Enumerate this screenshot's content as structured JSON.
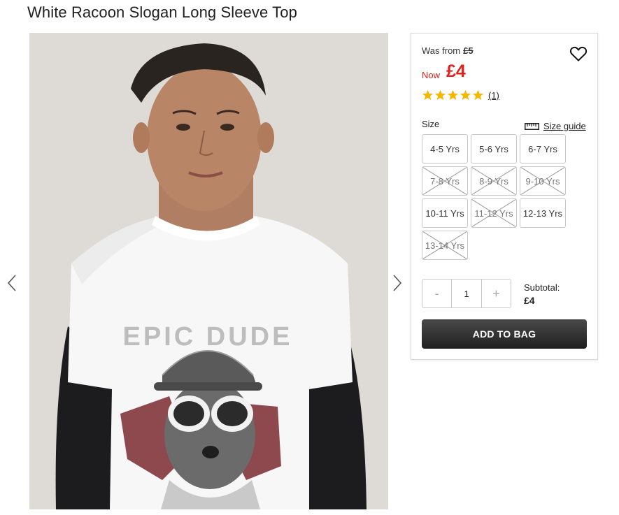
{
  "product": {
    "title": "White Racoon Slogan Long Sleeve Top",
    "image_alt": "Boy wearing white racoon slogan long sleeve top",
    "shirt_text": "EPIC DUDE"
  },
  "icons": {
    "prev": "chevron-left-icon",
    "next": "chevron-right-icon",
    "wishlist": "heart-icon",
    "rating": "star-icon",
    "size_guide": "ruler-icon"
  },
  "pricing": {
    "was_label": "Was from",
    "was_price": "£5",
    "now_label": "Now",
    "now_price": "£4",
    "sale_color": "#e0201e"
  },
  "rating": {
    "stars": 5,
    "max": 5,
    "count_label": "(1)",
    "star_color": "#f5b800"
  },
  "size": {
    "label": "Size",
    "guide_label": "Size guide",
    "options": [
      {
        "label": "4-5 Yrs",
        "available": true
      },
      {
        "label": "5-6 Yrs",
        "available": true
      },
      {
        "label": "6-7 Yrs",
        "available": true
      },
      {
        "label": "7-8 Yrs",
        "available": false
      },
      {
        "label": "8-9 Yrs",
        "available": false
      },
      {
        "label": "9-10 Yrs",
        "available": false
      },
      {
        "label": "10-11 Yrs",
        "available": true
      },
      {
        "label": "11-12 Yrs",
        "available": false
      },
      {
        "label": "12-13 Yrs",
        "available": true
      },
      {
        "label": "13-14 Yrs",
        "available": false
      }
    ]
  },
  "quantity": {
    "minus": "-",
    "value": "1",
    "plus": "+"
  },
  "subtotal": {
    "label": "Subtotal:",
    "value": "£4"
  },
  "cta": {
    "add_to_bag": "ADD TO BAG"
  }
}
